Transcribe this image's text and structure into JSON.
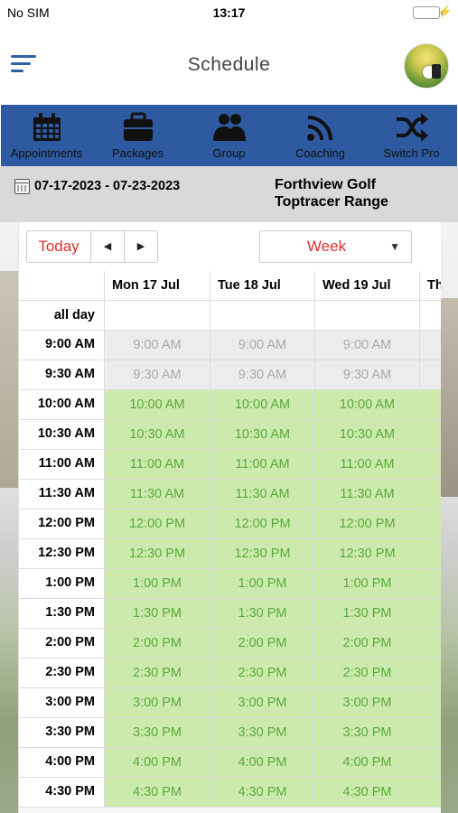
{
  "status_bar": {
    "carrier": "No SIM",
    "time": "13:17"
  },
  "header": {
    "title": "Schedule"
  },
  "toolbar": {
    "items": [
      {
        "label": "Appointments",
        "icon": "calendar-icon"
      },
      {
        "label": "Packages",
        "icon": "briefcase-icon"
      },
      {
        "label": "Group",
        "icon": "group-icon"
      },
      {
        "label": "Coaching",
        "icon": "signal-icon"
      },
      {
        "label": "Switch Pro",
        "icon": "shuffle-icon"
      }
    ]
  },
  "date_bar": {
    "range": "07-17-2023 - 07-23-2023",
    "venue_line1": "Forthview Golf",
    "venue_line2": "Toptracer Range"
  },
  "calendar": {
    "today_label": "Today",
    "prev_label": "◀",
    "next_label": "▶",
    "view_label": "Week",
    "days": [
      "Mon 17 Jul",
      "Tue 18 Jul",
      "Wed 19 Jul",
      "Th"
    ],
    "all_day_label": "all day",
    "times": [
      {
        "label": "9:00 AM",
        "available": false
      },
      {
        "label": "9:30 AM",
        "available": false
      },
      {
        "label": "10:00 AM",
        "available": true
      },
      {
        "label": "10:30 AM",
        "available": true
      },
      {
        "label": "11:00 AM",
        "available": true
      },
      {
        "label": "11:30 AM",
        "available": true
      },
      {
        "label": "12:00 PM",
        "available": true
      },
      {
        "label": "12:30 PM",
        "available": true
      },
      {
        "label": "1:00 PM",
        "available": true
      },
      {
        "label": "1:30 PM",
        "available": true
      },
      {
        "label": "2:00 PM",
        "available": true
      },
      {
        "label": "2:30 PM",
        "available": true
      },
      {
        "label": "3:00 PM",
        "available": true
      },
      {
        "label": "3:30 PM",
        "available": true
      },
      {
        "label": "4:00 PM",
        "available": true
      },
      {
        "label": "4:30 PM",
        "available": true
      }
    ]
  },
  "colors": {
    "accent_blue": "#2d5aa0",
    "red": "#d9322e",
    "available_bg": "#cdeaae",
    "available_text": "#5aaa3a",
    "unavailable_bg": "#ececec",
    "unavailable_text": "#a9a9a9"
  }
}
